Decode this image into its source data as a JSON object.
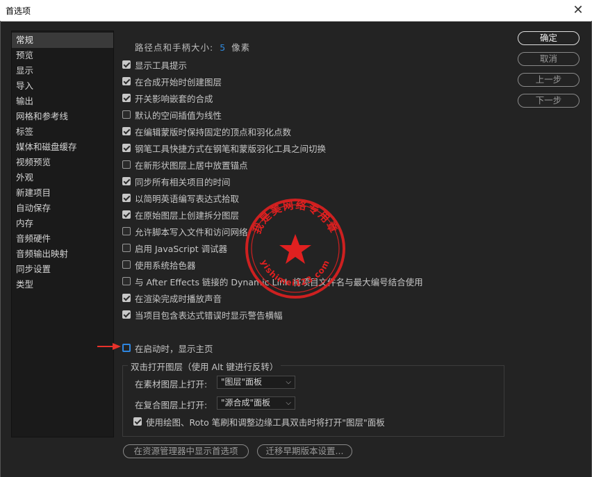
{
  "window": {
    "title": "首选项",
    "close_glyph": "✕"
  },
  "sidebar": {
    "items": [
      {
        "label": "常规",
        "active": true
      },
      {
        "label": "预览"
      },
      {
        "label": "显示"
      },
      {
        "label": "导入"
      },
      {
        "label": "输出"
      },
      {
        "label": "网格和参考线"
      },
      {
        "label": "标签"
      },
      {
        "label": "媒体和磁盘缓存"
      },
      {
        "label": "视频预览"
      },
      {
        "label": "外观"
      },
      {
        "label": "新建项目"
      },
      {
        "label": "自动保存"
      },
      {
        "label": "内存"
      },
      {
        "label": "音频硬件"
      },
      {
        "label": "音频输出映射"
      },
      {
        "label": "同步设置"
      },
      {
        "label": "类型"
      }
    ]
  },
  "general": {
    "path_handle_label": "路径点和手柄大小:",
    "path_handle_value": "5",
    "path_handle_unit": "像素",
    "options": [
      {
        "label": "显示工具提示",
        "checked": true
      },
      {
        "label": "在合成开始时创建图层",
        "checked": true
      },
      {
        "label": "开关影响嵌套的合成",
        "checked": true
      },
      {
        "label": "默认的空间插值为线性",
        "checked": false
      },
      {
        "label": "在编辑蒙版时保持固定的顶点和羽化点数",
        "checked": true
      },
      {
        "label": "钢笔工具快捷方式在钢笔和蒙版羽化工具之间切换",
        "checked": true
      },
      {
        "label": "在新形状图层上居中放置锚点",
        "checked": false
      },
      {
        "label": "同步所有相关项目的时间",
        "checked": true
      },
      {
        "label": "以简明英语编写表达式拾取",
        "checked": true
      },
      {
        "label": "在原始图层上创建拆分图层",
        "checked": true
      },
      {
        "label": "允许脚本写入文件和访问网络",
        "checked": false
      },
      {
        "label": "启用 JavaScript 调试器",
        "checked": false
      },
      {
        "label": "使用系统拾色器",
        "checked": false
      },
      {
        "label": "与 After Effects 链接的 Dynamic Link 将项目文件名与最大编号结合使用",
        "checked": false
      },
      {
        "label": "在渲染完成时播放声音",
        "checked": true
      },
      {
        "label": "当项目包含表达式错误时显示警告横幅",
        "checked": true
      }
    ],
    "startup_home": {
      "label": "在启动时，显示主页",
      "checked": false
    }
  },
  "double_click_group": {
    "title": "双击打开图层（使用 Alt 键进行反转）",
    "footage_label": "在素材图层上打开:",
    "footage_value": "\"图层\"面板",
    "comp_label": "在复合图层上打开:",
    "comp_value": "\"源合成\"面板",
    "paint_option": {
      "label": "使用绘图、Roto 笔刷和调整边缘工具双击时将打开\"图层\"面板",
      "checked": true
    }
  },
  "bottom_buttons": {
    "reveal": "在资源管理器中显示首选项",
    "migrate": "迁移早期版本设置..."
  },
  "right_buttons": {
    "ok": "确定",
    "cancel": "取消",
    "prev": "上一步",
    "next": "下一步"
  },
  "watermark": {
    "text": "我是美网络专用章",
    "url": "yishimei123.com",
    "color": "#e02020"
  },
  "colors": {
    "accent": "#2f8be0",
    "arrow": "#e8322a",
    "bg": "#232323"
  }
}
